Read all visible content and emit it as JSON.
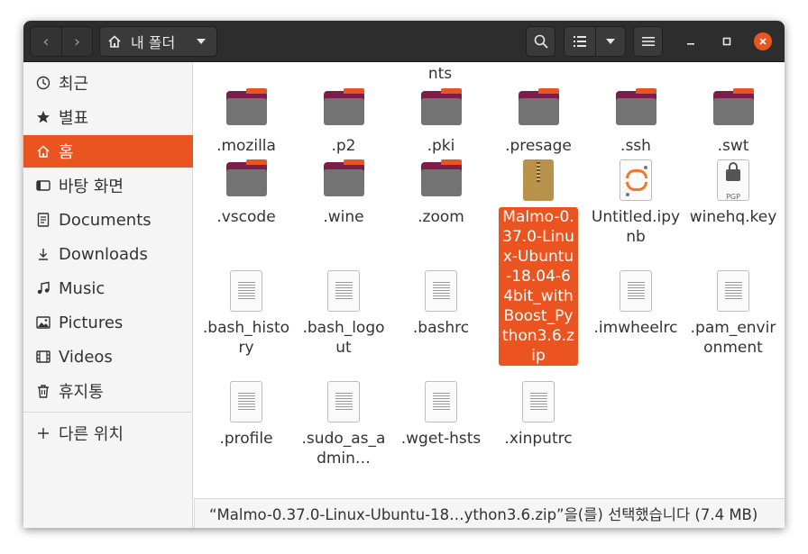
{
  "header": {
    "back_icon": "‹",
    "forward_icon": "›",
    "path_label": "내 폴더",
    "colors": {
      "bar": "#2d2d2d",
      "accent": "#e95420"
    }
  },
  "sidebar": {
    "items": [
      {
        "label": "최근",
        "icon": "clock-icon"
      },
      {
        "label": "별표",
        "icon": "star-icon"
      },
      {
        "label": "홈",
        "icon": "home-icon",
        "active": true
      },
      {
        "label": "바탕 화면",
        "icon": "desktop-icon"
      },
      {
        "label": "Documents",
        "icon": "document-icon"
      },
      {
        "label": "Downloads",
        "icon": "download-icon"
      },
      {
        "label": "Music",
        "icon": "music-icon"
      },
      {
        "label": "Pictures",
        "icon": "picture-icon"
      },
      {
        "label": "Videos",
        "icon": "video-icon"
      },
      {
        "label": "휴지통",
        "icon": "trash-icon"
      },
      {
        "label": "다른 위치",
        "icon": "plus-icon"
      }
    ]
  },
  "content": {
    "partial_top_label": "nts",
    "items": [
      {
        "label": ".mozilla",
        "type": "folder"
      },
      {
        "label": ".p2",
        "type": "folder"
      },
      {
        "label": ".pki",
        "type": "folder"
      },
      {
        "label": ".presage",
        "type": "folder"
      },
      {
        "label": ".ssh",
        "type": "folder"
      },
      {
        "label": ".swt",
        "type": "folder"
      },
      {
        "label": ".vscode",
        "type": "folder"
      },
      {
        "label": ".wine",
        "type": "folder"
      },
      {
        "label": ".zoom",
        "type": "folder"
      },
      {
        "label": "Malmo-0.37.0-Linux-Ubuntu-18.04-64bit_withBoost_Python3.6.zip",
        "type": "zip",
        "selected": true
      },
      {
        "label": "Untitled.ipynb",
        "type": "ipynb"
      },
      {
        "label": "winehq.key",
        "type": "pgp",
        "badge": "PGP"
      },
      {
        "label": ".bash_history",
        "type": "text"
      },
      {
        "label": ".bash_logout",
        "type": "text"
      },
      {
        "label": ".bashrc",
        "type": "text"
      },
      {
        "label": ".imwheelrc",
        "type": "text"
      },
      {
        "label": ".pam_environment",
        "type": "text"
      },
      {
        "label": ".profile",
        "type": "text"
      },
      {
        "label": ".sudo_as_admin…",
        "type": "text"
      },
      {
        "label": ".wget-hsts",
        "type": "text"
      },
      {
        "label": ".xinputrc",
        "type": "text"
      }
    ]
  },
  "status": {
    "text": "“Malmo-0.37.0-Linux-Ubuntu-18…ython3.6.zip”을(를) 선택했습니다  (7.4 MB)"
  }
}
